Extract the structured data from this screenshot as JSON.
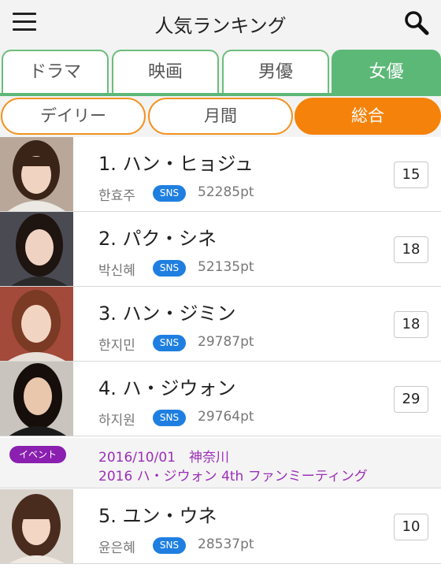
{
  "header": {
    "title": "人気ランキング",
    "menu_icon": "hamburger-icon",
    "search_icon": "search-icon"
  },
  "tabs": [
    {
      "label": "ドラマ",
      "active": false
    },
    {
      "label": "映画",
      "active": false
    },
    {
      "label": "男優",
      "active": false
    },
    {
      "label": "女優",
      "active": true
    }
  ],
  "periods": [
    {
      "label": "デイリー",
      "active": false
    },
    {
      "label": "月間",
      "active": false
    },
    {
      "label": "総合",
      "active": true
    }
  ],
  "colors": {
    "tab_green": "#5cb877",
    "period_orange": "#f5820a",
    "sns_blue": "#1f7fe0",
    "event_purple": "#8a1fb0"
  },
  "rankings": [
    {
      "name": "1. ハン・ヒョジュ",
      "korean": "한효주",
      "sns": "SNS",
      "points": "52285pt",
      "count": "15"
    },
    {
      "name": "2. パク・シネ",
      "korean": "박신혜",
      "sns": "SNS",
      "points": "52135pt",
      "count": "18"
    },
    {
      "name": "3. ハン・ジミン",
      "korean": "한지민",
      "sns": "SNS",
      "points": "29787pt",
      "count": "18"
    },
    {
      "name": "4. ハ・ジウォン",
      "korean": "하지원",
      "sns": "SNS",
      "points": "29764pt",
      "count": "29"
    },
    {
      "name": "5. ユン・ウネ",
      "korean": "윤은혜",
      "sns": "SNS",
      "points": "28537pt",
      "count": "10"
    }
  ],
  "event": {
    "badge": "イベント",
    "date_place": "2016/10/01　神奈川",
    "title": "2016 ハ・ジウォン 4th ファンミーティング"
  }
}
